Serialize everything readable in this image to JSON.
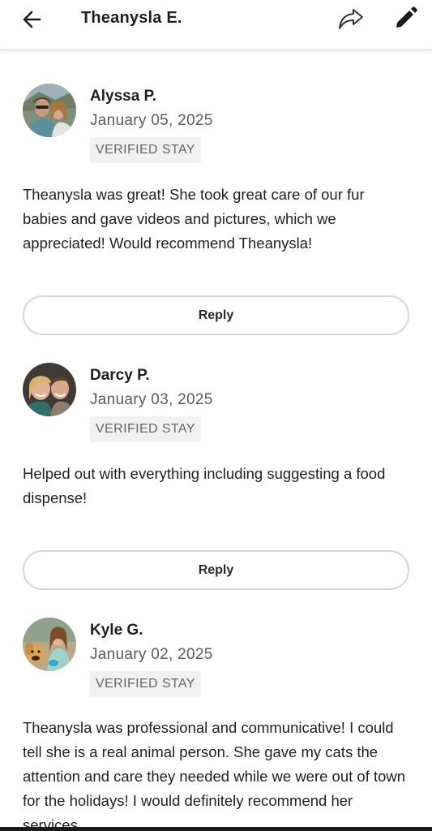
{
  "header": {
    "title": "Theanysla E.",
    "back_icon": "arrow-left-icon",
    "share_icon": "share-forward-icon",
    "edit_icon": "pencil-icon"
  },
  "reviews": [
    {
      "name": "Alyssa P.",
      "date": "January 05, 2025",
      "badge": "VERIFIED STAY",
      "text": "Theanysla was great! She took great care of our fur babies and gave videos and pictures, which we appreciated! Would recommend Theanysla!",
      "reply_label": "Reply"
    },
    {
      "name": "Darcy P.",
      "date": "January 03, 2025",
      "badge": "VERIFIED STAY",
      "text": "Helped out with everything including suggesting a food dispense!",
      "reply_label": "Reply"
    },
    {
      "name": "Kyle G.",
      "date": "January 02, 2025",
      "badge": "VERIFIED STAY",
      "text": "Theanysla was professional and communicative! I could tell she is a real animal person. She gave my cats the attention and care they needed while we were out of town for the holidays! I would definitely recommend her services."
    }
  ],
  "colors": {
    "badge_bg": "#f1f1f1",
    "reply_border": "#d6d6d6",
    "text": "#1f1f1f",
    "muted": "#5b5b5b"
  }
}
